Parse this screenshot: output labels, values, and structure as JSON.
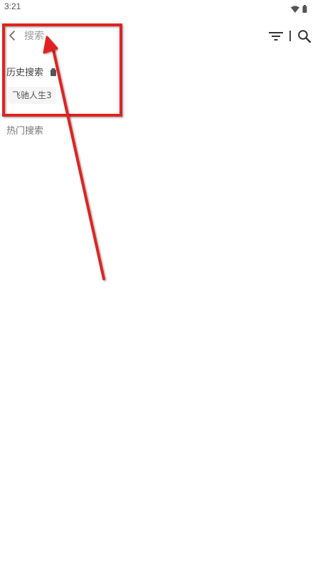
{
  "status_bar": {
    "time": "3:21",
    "icons": [
      "wifi-icon",
      "battery-icon"
    ]
  },
  "search_bar": {
    "back_icon": "chevron-left-icon",
    "placeholder": "搜索",
    "filter_icon": "filter-icon",
    "search_icon": "search-icon"
  },
  "history": {
    "title": "历史搜索",
    "delete_icon": "trash-icon",
    "items": [
      {
        "label": "飞驰人生3"
      }
    ]
  },
  "hot": {
    "title": "热门搜索"
  },
  "annotation": {
    "color": "#e02020"
  }
}
